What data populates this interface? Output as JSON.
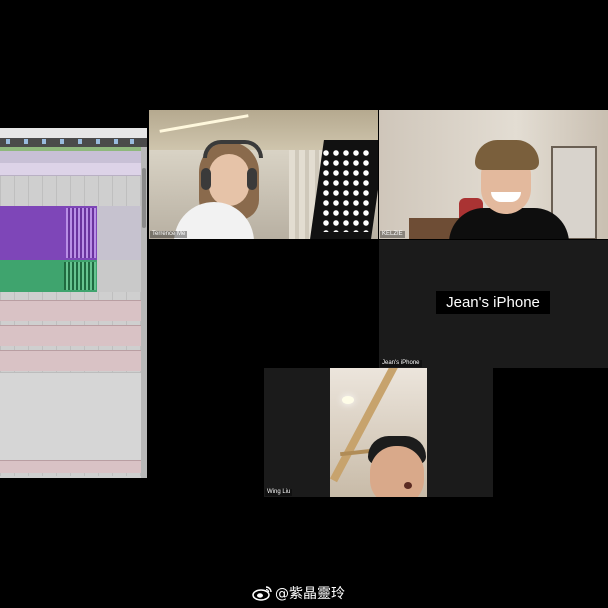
{
  "participants": {
    "terrence": {
      "label": "Terrence Me"
    },
    "kelzie": {
      "label": "KELZIE"
    },
    "jean": {
      "label": "Jean's iPhone",
      "display_name": "Jean's iPhone"
    },
    "wing": {
      "label": "Wing Liu"
    }
  },
  "watermark": {
    "icon": "weibo-icon",
    "text": "@紫晶靈玲"
  },
  "colors": {
    "daw_purple": "#7e46b8",
    "daw_green": "#3fa46e",
    "background": "#000000"
  }
}
